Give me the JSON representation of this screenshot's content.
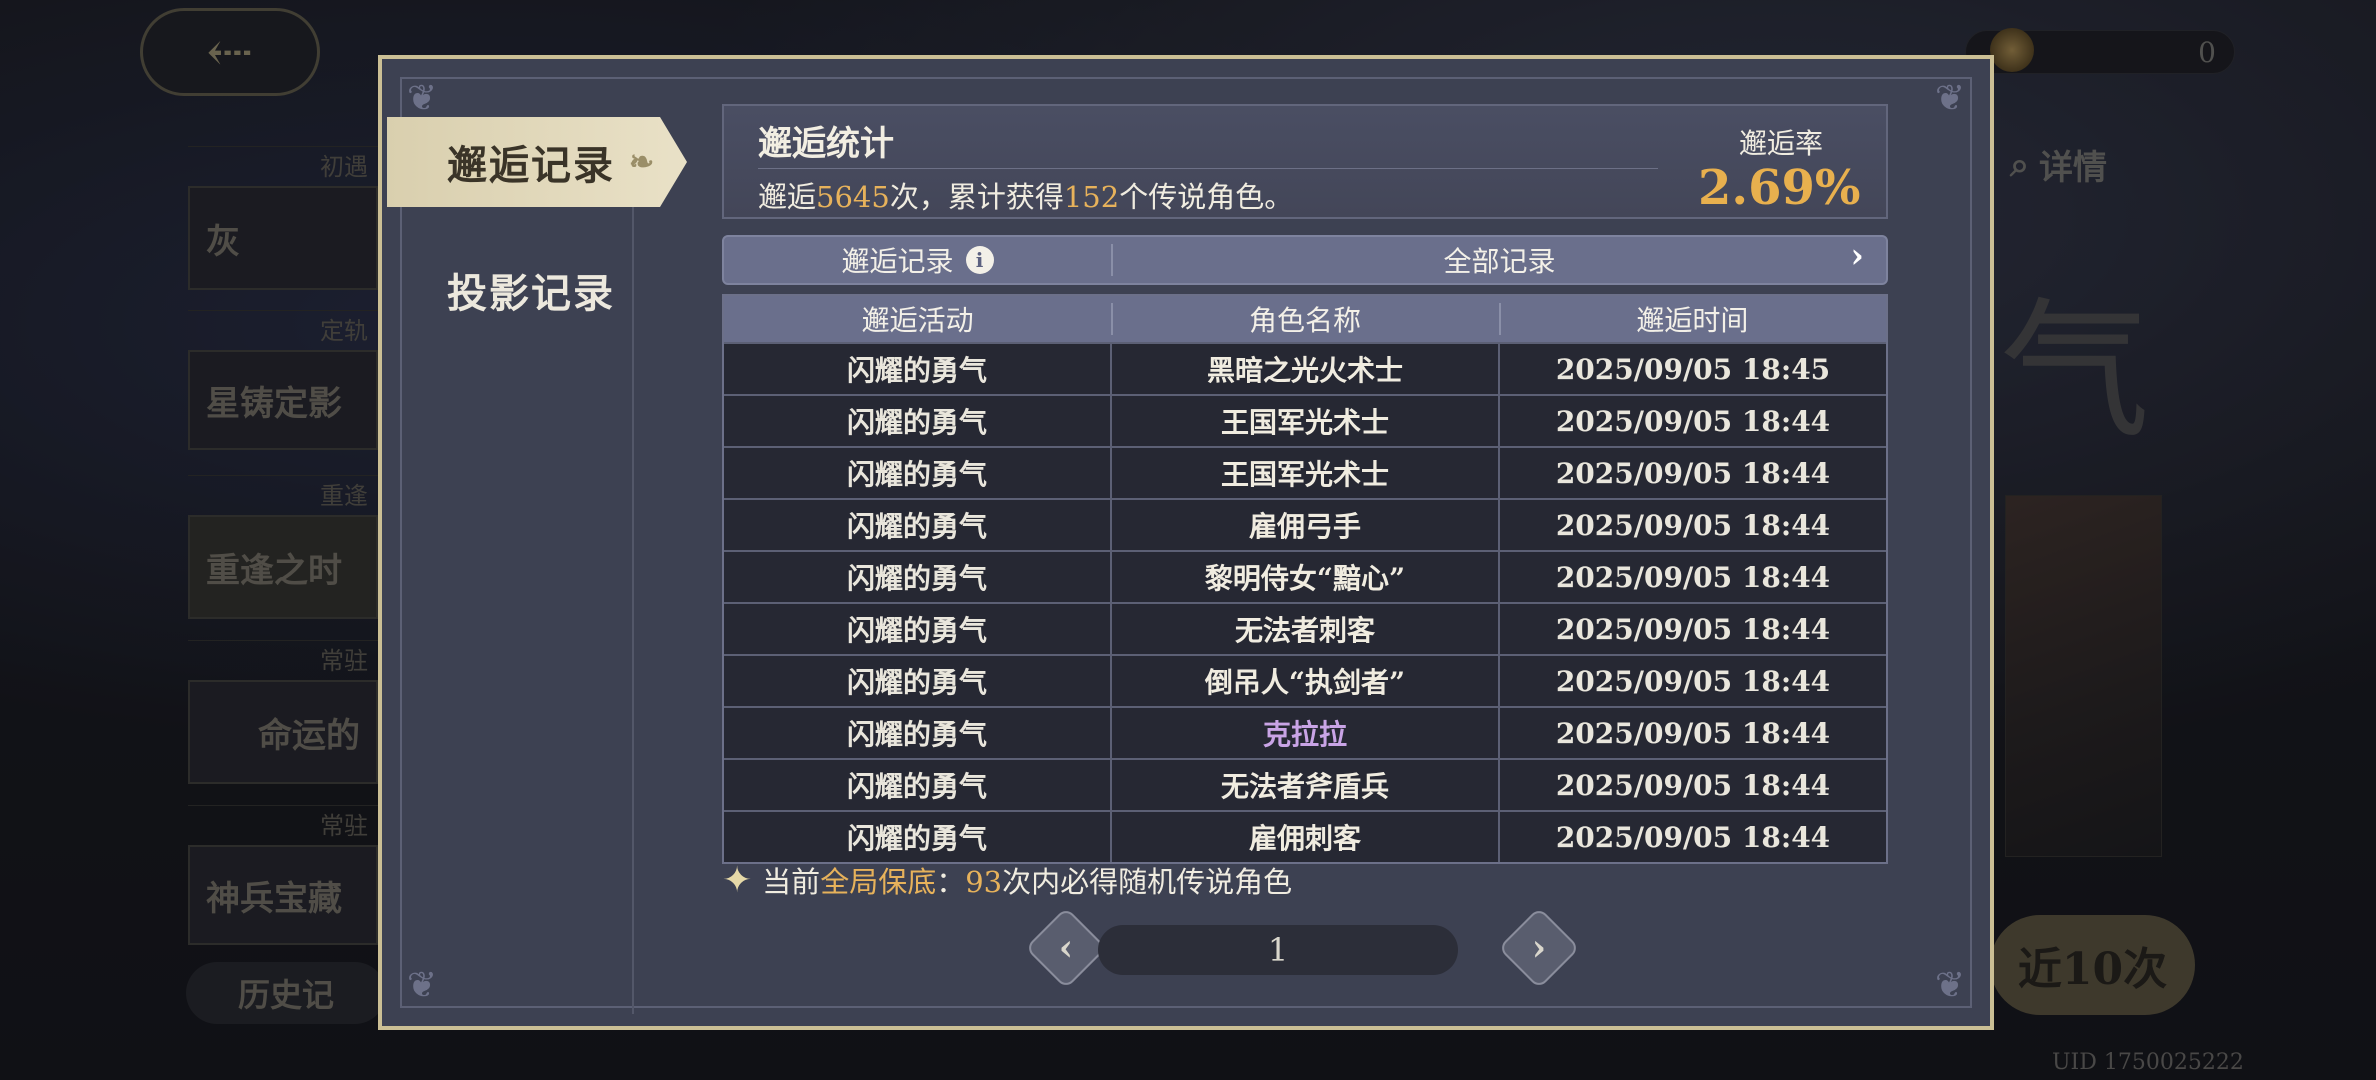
{
  "background": {
    "back_icon": "back-arrow-icon",
    "left_cards": [
      {
        "tag": "初遇",
        "label": "灰"
      },
      {
        "tag": "定轨",
        "label": "星铸定影"
      },
      {
        "tag": "重逢",
        "label": "重逢之时"
      },
      {
        "tag": "常驻",
        "label": "命运的"
      },
      {
        "tag": "常驻",
        "label": "神兵宝藏"
      }
    ],
    "history_label": "历史记",
    "currency_value": "0",
    "detail_label": "详情",
    "big_char": "气",
    "pull10_label": "近10次",
    "uid": "UID 1750025222"
  },
  "dialog": {
    "tabs": [
      {
        "label": "邂逅记录",
        "active": true
      },
      {
        "label": "投影记录",
        "active": false
      }
    ],
    "stats": {
      "title": "邂逅统计",
      "desc_prefix": "邂逅",
      "count": "5645",
      "desc_mid": "次，累计获得",
      "legend_count": "152",
      "desc_suffix": "个传说角色。",
      "rate_label": "邂逅率",
      "rate_value": "2.69%"
    },
    "filter": {
      "left_label": "邂逅记录",
      "info_icon": "i",
      "right_label": "全部记录",
      "chevron": "›"
    },
    "table": {
      "headers": [
        "邂逅活动",
        "角色名称",
        "邂逅时间"
      ],
      "rows": [
        {
          "activity": "闪耀的勇气",
          "name": "黑暗之光火术士",
          "time": "2025/09/05 18:45",
          "name_color": "#f0ece0"
        },
        {
          "activity": "闪耀的勇气",
          "name": "王国军光术士",
          "time": "2025/09/05 18:44",
          "name_color": "#f0ece0"
        },
        {
          "activity": "闪耀的勇气",
          "name": "王国军光术士",
          "time": "2025/09/05 18:44",
          "name_color": "#f0ece0"
        },
        {
          "activity": "闪耀的勇气",
          "name": "雇佣弓手",
          "time": "2025/09/05 18:44",
          "name_color": "#f0ece0"
        },
        {
          "activity": "闪耀的勇气",
          "name": "黎明侍女“黯心”",
          "time": "2025/09/05 18:44",
          "name_color": "#f0ece0"
        },
        {
          "activity": "闪耀的勇气",
          "name": "无法者刺客",
          "time": "2025/09/05 18:44",
          "name_color": "#f0ece0"
        },
        {
          "activity": "闪耀的勇气",
          "name": "倒吊人“执剑者”",
          "time": "2025/09/05 18:44",
          "name_color": "#f0ece0"
        },
        {
          "activity": "闪耀的勇气",
          "name": "克拉拉",
          "time": "2025/09/05 18:44",
          "name_color": "#c9a4e6"
        },
        {
          "activity": "闪耀的勇气",
          "name": "无法者斧盾兵",
          "time": "2025/09/05 18:44",
          "name_color": "#f0ece0"
        },
        {
          "activity": "闪耀的勇气",
          "name": "雇佣刺客",
          "time": "2025/09/05 18:44",
          "name_color": "#f0ece0"
        }
      ]
    },
    "pity": {
      "prefix": "当前",
      "highlight": "全局保底",
      "colon": "：",
      "count": "93",
      "suffix": "次内必得随机传说角色"
    },
    "pager": {
      "prev": "‹",
      "page": "1",
      "next": "›"
    }
  }
}
